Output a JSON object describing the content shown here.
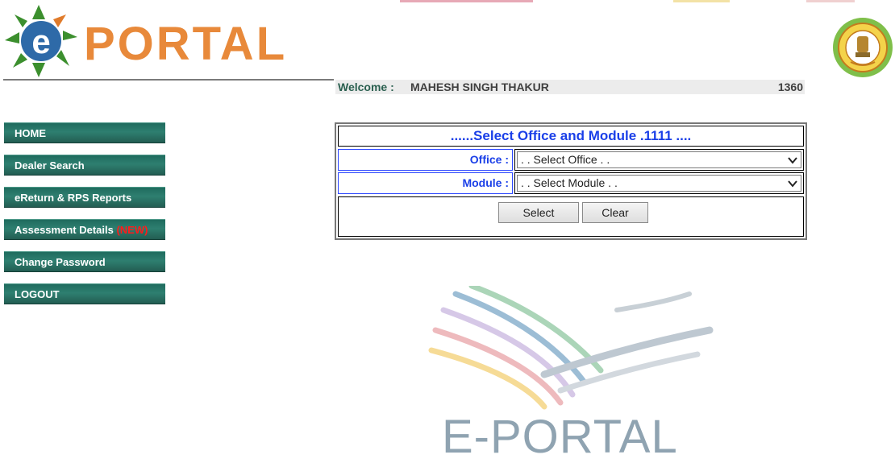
{
  "logo": {
    "text": "PORTAL",
    "letter": "e"
  },
  "welcome": {
    "label": "Welcome :",
    "name": "MAHESH SINGH THAKUR",
    "code": "1360"
  },
  "sidebar": {
    "items": [
      {
        "label": "HOME"
      },
      {
        "label": "Dealer Search"
      },
      {
        "label": "eReturn & RPS Reports"
      },
      {
        "label": "Assessment Details",
        "badge": "(NEW)"
      },
      {
        "label": "Change Password"
      },
      {
        "label": "LOGOUT"
      }
    ]
  },
  "panel": {
    "title": "......Select Office and Module .1111 ....",
    "office_label": "Office :",
    "office_selected": ". . Select Office . .",
    "module_label": "Module :",
    "module_selected": ". . Select Module . .",
    "select_button": "Select",
    "clear_button": "Clear"
  },
  "watermark": {
    "text": "E-PORTAL"
  },
  "colors": {
    "nav_green": "#2e7f70",
    "title_blue": "#1a3fe8",
    "logo_orange": "#e8893a",
    "new_red": "#ff1b1b"
  },
  "icons": {
    "logo": "eportal-logo-icon",
    "emblem": "state-emblem-icon",
    "dropdown": "chevron-down-icon",
    "watermark": "handshake-swoosh-icon"
  }
}
